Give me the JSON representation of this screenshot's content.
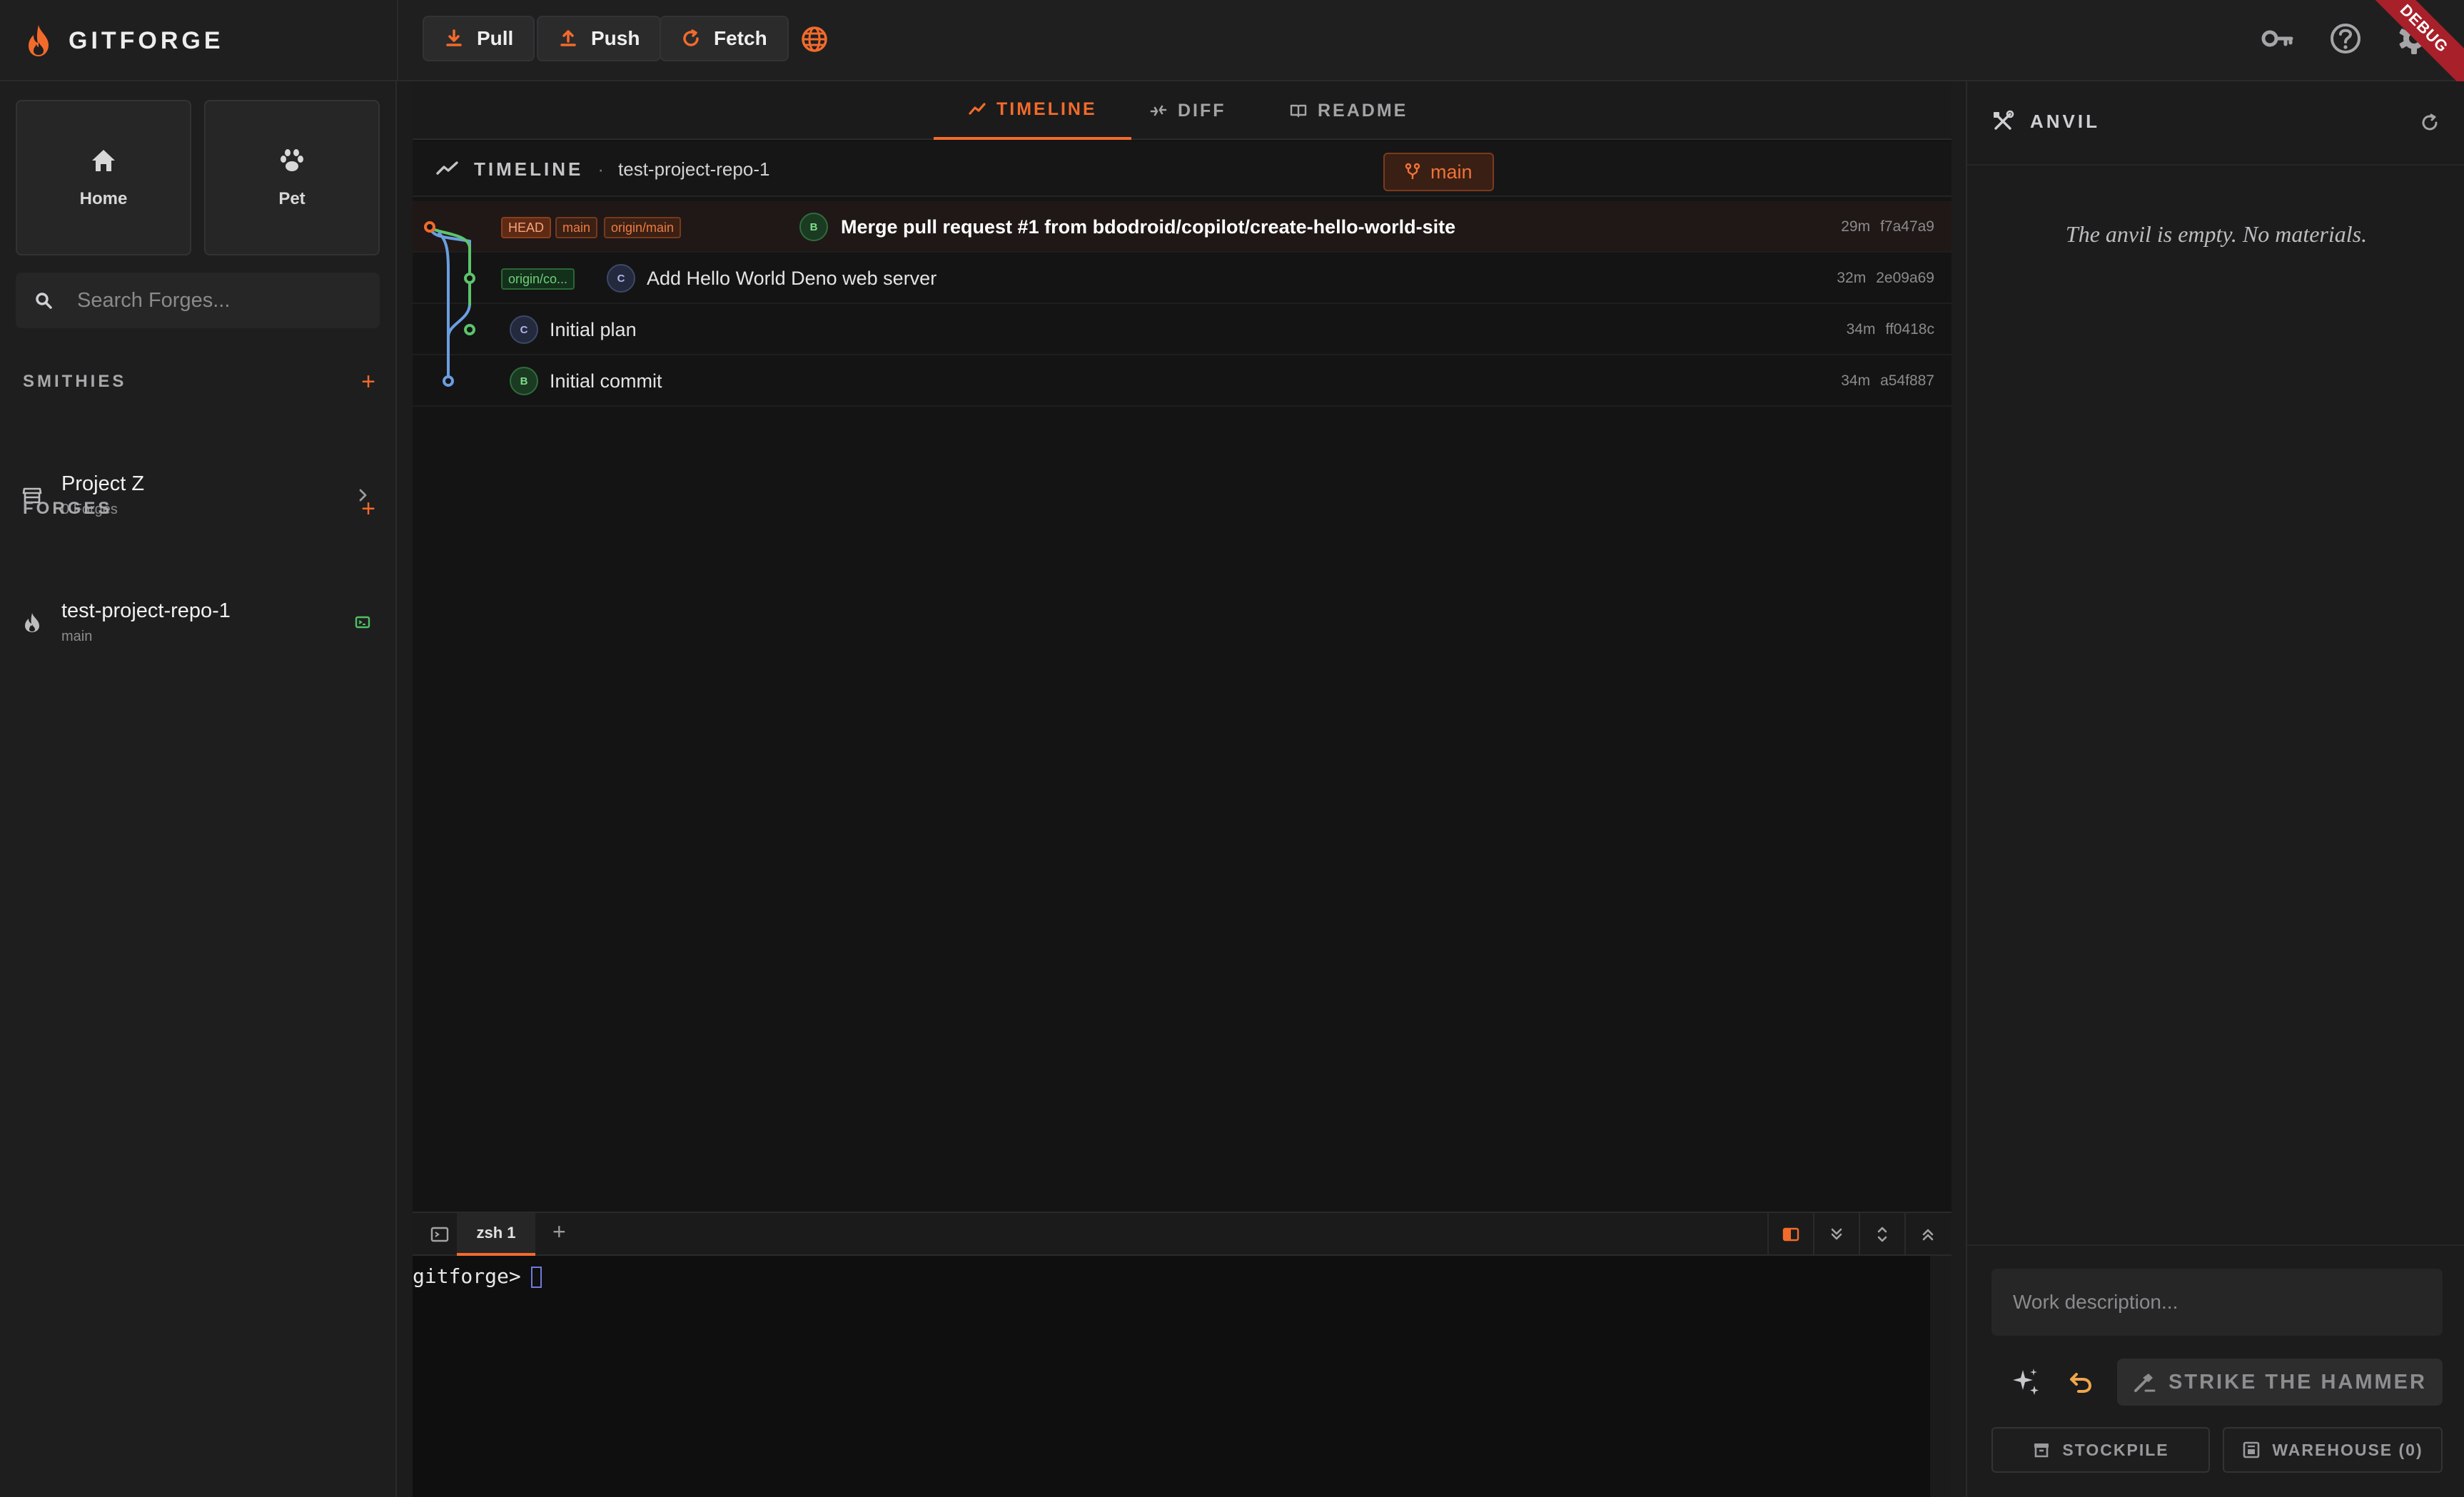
{
  "brand": {
    "name": "GITFORGE"
  },
  "toolbar": {
    "pull_label": "Pull",
    "push_label": "Push",
    "fetch_label": "Fetch",
    "badge": "DEBUG"
  },
  "nav": {
    "home_label": "Home",
    "pet_label": "Pet"
  },
  "search": {
    "placeholder": "Search Forges..."
  },
  "smithies": {
    "heading": "SMITHIES",
    "add": "+",
    "items": [
      {
        "name": "Project Z",
        "sub": "0 Forges"
      }
    ]
  },
  "forges": {
    "heading": "FORGES",
    "add": "+",
    "items": [
      {
        "name": "test-project-repo-1",
        "sub": "main"
      }
    ]
  },
  "tabs": [
    {
      "label": "TIMELINE",
      "active": true
    },
    {
      "label": "DIFF",
      "active": false
    },
    {
      "label": "README",
      "active": false
    }
  ],
  "timeline": {
    "title": "TIMELINE",
    "separator": "·",
    "repo": "test-project-repo-1",
    "branch": "main"
  },
  "commits": [
    {
      "tags": [
        "HEAD",
        "main",
        "origin/main"
      ],
      "avatar": "B",
      "message": "Merge pull request #1 from bdodroid/copilot/create-hello-world-site",
      "age": "29m",
      "hash": "f7a47a9",
      "selected": true
    },
    {
      "tags": [
        "origin/co..."
      ],
      "avatar": "C",
      "message": "Add Hello World Deno web server",
      "age": "32m",
      "hash": "2e09a69",
      "selected": false
    },
    {
      "tags": [],
      "avatar": "C",
      "message": "Initial plan",
      "age": "34m",
      "hash": "ff0418c",
      "selected": false
    },
    {
      "tags": [],
      "avatar": "B",
      "message": "Initial commit",
      "age": "34m",
      "hash": "a54f887",
      "selected": false
    }
  ],
  "terminal": {
    "tab_label": "zsh 1",
    "add": "+",
    "prompt": "gitforge>"
  },
  "anvil": {
    "title": "ANVIL",
    "empty_text": "The anvil is empty. No materials.",
    "work_placeholder": "Work description...",
    "strike_label": "STRIKE THE HAMMER",
    "stockpile_label": "STOCKPILE",
    "warehouse_label": "WAREHOUSE (0)"
  },
  "colors": {
    "accent": "#f26b2b",
    "graph_main": "#f26b2b",
    "graph_green": "#5cc46b",
    "graph_blue": "#6b9ee0"
  }
}
